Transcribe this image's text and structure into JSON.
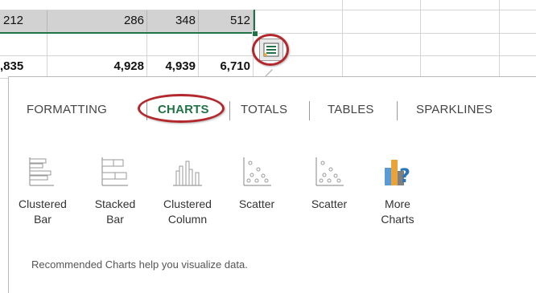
{
  "sheet": {
    "row1": [
      "212",
      "286",
      "348",
      "512"
    ],
    "row3": [
      ",835",
      "4,928",
      "4,939",
      "6,710"
    ]
  },
  "quick_analysis": {
    "button_icon": "quick-analysis-icon",
    "tabs": [
      {
        "label": "FORMATTING",
        "active": false
      },
      {
        "label": "CHARTS",
        "active": true
      },
      {
        "label": "TOTALS",
        "active": false
      },
      {
        "label": "TABLES",
        "active": false
      },
      {
        "label": "SPARKLINES",
        "active": false
      }
    ],
    "charts": [
      {
        "label": "Clustered\nBar",
        "icon": "clustered-bar-chart-icon"
      },
      {
        "label": "Stacked\nBar",
        "icon": "stacked-bar-chart-icon"
      },
      {
        "label": "Clustered\nColumn",
        "icon": "clustered-column-chart-icon"
      },
      {
        "label": "Scatter",
        "icon": "scatter-chart-icon"
      },
      {
        "label": "Scatter",
        "icon": "scatter-chart-icon"
      },
      {
        "label": "More\nCharts",
        "icon": "more-charts-icon"
      }
    ],
    "hint": "Recommended Charts help you visualize data."
  },
  "colors": {
    "accent": "#217346",
    "highlight_ring": "#b3282d",
    "selection": "#d2d2d2"
  }
}
